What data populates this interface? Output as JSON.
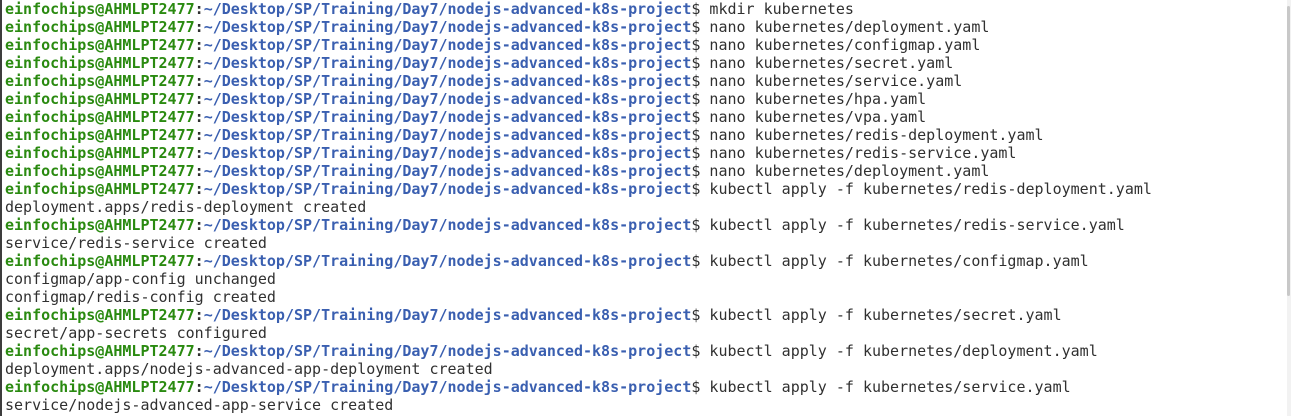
{
  "prompt": {
    "user_host": "einfochips@AHMLPT2477",
    "separator": ":",
    "path": "~/Desktop/SP/Training/Day7/nodejs-advanced-k8s-project",
    "symbol": "$"
  },
  "lines": [
    {
      "type": "cmd",
      "text": " mkdir kubernetes"
    },
    {
      "type": "cmd",
      "text": " nano kubernetes/deployment.yaml"
    },
    {
      "type": "cmd",
      "text": " nano kubernetes/configmap.yaml"
    },
    {
      "type": "cmd",
      "text": " nano kubernetes/secret.yaml"
    },
    {
      "type": "cmd",
      "text": " nano kubernetes/service.yaml"
    },
    {
      "type": "cmd",
      "text": " nano kubernetes/hpa.yaml"
    },
    {
      "type": "cmd",
      "text": " nano kubernetes/vpa.yaml"
    },
    {
      "type": "cmd",
      "text": " nano kubernetes/redis-deployment.yaml"
    },
    {
      "type": "cmd",
      "text": " nano kubernetes/redis-service.yaml"
    },
    {
      "type": "cmd",
      "text": " nano kubernetes/deployment.yaml"
    },
    {
      "type": "cmd",
      "text": " kubectl apply -f kubernetes/redis-deployment.yaml"
    },
    {
      "type": "out",
      "text": "deployment.apps/redis-deployment created"
    },
    {
      "type": "cmd",
      "text": " kubectl apply -f kubernetes/redis-service.yaml"
    },
    {
      "type": "out",
      "text": "service/redis-service created"
    },
    {
      "type": "cmd",
      "text": " kubectl apply -f kubernetes/configmap.yaml"
    },
    {
      "type": "out",
      "text": "configmap/app-config unchanged"
    },
    {
      "type": "out",
      "text": "configmap/redis-config created"
    },
    {
      "type": "cmd",
      "text": " kubectl apply -f kubernetes/secret.yaml"
    },
    {
      "type": "out",
      "text": "secret/app-secrets configured"
    },
    {
      "type": "cmd",
      "text": " kubectl apply -f kubernetes/deployment.yaml"
    },
    {
      "type": "out",
      "text": "deployment.apps/nodejs-advanced-app-deployment created"
    },
    {
      "type": "cmd",
      "text": " kubectl apply -f kubernetes/service.yaml"
    },
    {
      "type": "out",
      "text": "service/nodejs-advanced-app-service created"
    }
  ]
}
